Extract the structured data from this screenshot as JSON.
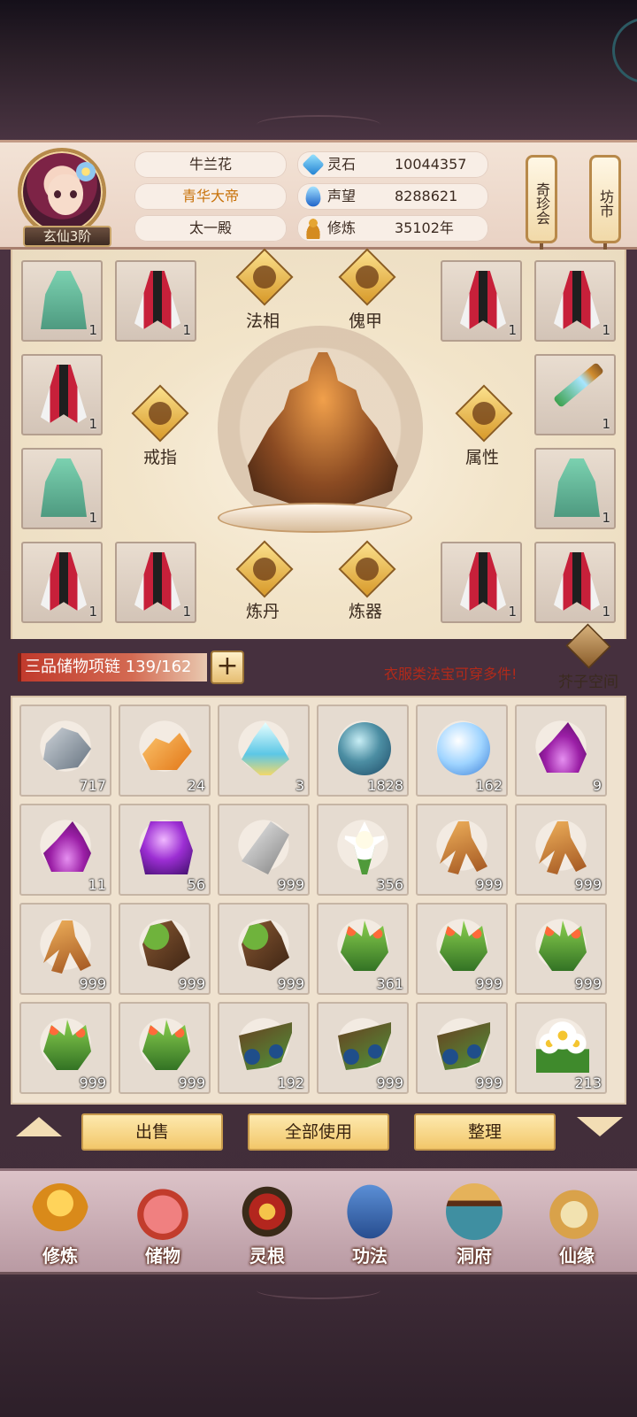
{
  "player": {
    "rank": "玄仙3阶",
    "name": "牛兰花",
    "title": "青华大帝",
    "sect": "太一殿"
  },
  "stats": [
    {
      "icon": "spirit-stone-icon",
      "label": "灵石",
      "value": "10044357"
    },
    {
      "icon": "reputation-icon",
      "label": "声望",
      "value": "8288621"
    },
    {
      "icon": "cultivation-icon",
      "label": "修炼",
      "value": "35102年"
    }
  ],
  "banners": {
    "treasure_fair": "奇珍会",
    "market": "坊市"
  },
  "equipment": {
    "slots": [
      "1",
      "1",
      "1",
      "1",
      "1",
      "1",
      "1",
      "1",
      "1",
      "1",
      "1",
      "1"
    ],
    "labels": {
      "dharma": "法相",
      "puppet": "傀甲",
      "ring": "戒指",
      "attributes": "属性",
      "alchemy": "炼丹",
      "forging": "炼器"
    }
  },
  "storage": {
    "capacity": "三品储物项链 139/162",
    "hint": "衣服类法宝可穿多件!",
    "space_label": "芥子空间",
    "plus": "+"
  },
  "inventory": [
    {
      "icon": "ore-icon",
      "count": "717"
    },
    {
      "icon": "amber-icon",
      "count": "24"
    },
    {
      "icon": "crystal-icon",
      "count": "3"
    },
    {
      "icon": "water-orb-icon",
      "count": "1828"
    },
    {
      "icon": "light-orb-icon",
      "count": "162"
    },
    {
      "icon": "purple-flame-icon",
      "count": "9"
    },
    {
      "icon": "purple-flame-icon",
      "count": "11"
    },
    {
      "icon": "purple-orb-icon",
      "count": "56"
    },
    {
      "icon": "stone-icon",
      "count": "999"
    },
    {
      "icon": "lily-icon",
      "count": "356"
    },
    {
      "icon": "ginseng-icon",
      "count": "999"
    },
    {
      "icon": "ginseng-icon",
      "count": "999"
    },
    {
      "icon": "ginseng-icon",
      "count": "999"
    },
    {
      "icon": "tuber-icon",
      "count": "999"
    },
    {
      "icon": "tuber-icon",
      "count": "999"
    },
    {
      "icon": "herb-icon",
      "count": "361"
    },
    {
      "icon": "herb-icon",
      "count": "999"
    },
    {
      "icon": "herb-icon",
      "count": "999"
    },
    {
      "icon": "herb-icon",
      "count": "999"
    },
    {
      "icon": "herb-icon",
      "count": "999"
    },
    {
      "icon": "berry-branch-icon",
      "count": "192"
    },
    {
      "icon": "berry-branch-icon",
      "count": "999"
    },
    {
      "icon": "berry-branch-icon",
      "count": "999"
    },
    {
      "icon": "daisy-icon",
      "count": "213"
    }
  ],
  "actions": {
    "sell": "出售",
    "use_all": "全部使用",
    "sort": "整理"
  },
  "nav": [
    {
      "icon": "cultivate-nav-icon",
      "label": "修炼"
    },
    {
      "icon": "storage-nav-icon",
      "label": "储物"
    },
    {
      "icon": "spirit-root-nav-icon",
      "label": "灵根"
    },
    {
      "icon": "skill-nav-icon",
      "label": "功法"
    },
    {
      "icon": "cave-nav-icon",
      "label": "洞府"
    },
    {
      "icon": "fate-nav-icon",
      "label": "仙缘"
    }
  ]
}
